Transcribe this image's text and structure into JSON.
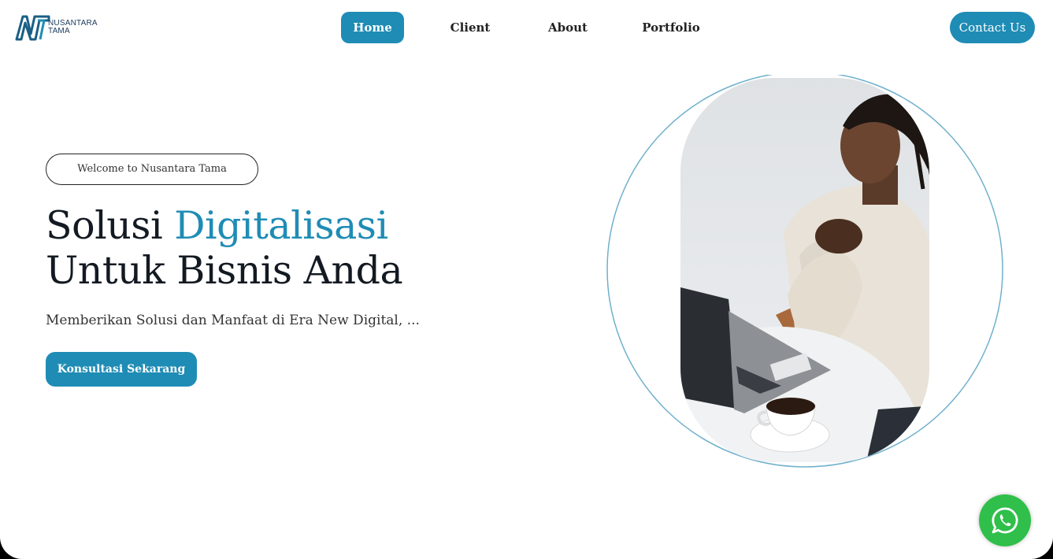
{
  "header": {
    "logo": {
      "line1": "NUSANTARA",
      "line2": "TAMA"
    },
    "nav": [
      {
        "label": "Home",
        "active": true
      },
      {
        "label": "Client",
        "active": false
      },
      {
        "label": "About",
        "active": false
      },
      {
        "label": "Portfolio",
        "active": false
      }
    ],
    "contact_label": "Contact Us"
  },
  "hero": {
    "badge": "Welcome to Nusantara Tama",
    "headline_part1": "Solusi ",
    "headline_accent": "Digitalisasi",
    "headline_line2": "Untuk Bisnis Anda",
    "subtext": "Memberikan Solusi dan Manfaat di Era New Digital, ...",
    "cta_label": "Konsultasi Sekarang"
  },
  "floating": {
    "icon": "whatsapp-icon"
  },
  "colors": {
    "accent": "#1f8cb5",
    "whatsapp": "#2fbf4a",
    "text": "#141a22"
  }
}
